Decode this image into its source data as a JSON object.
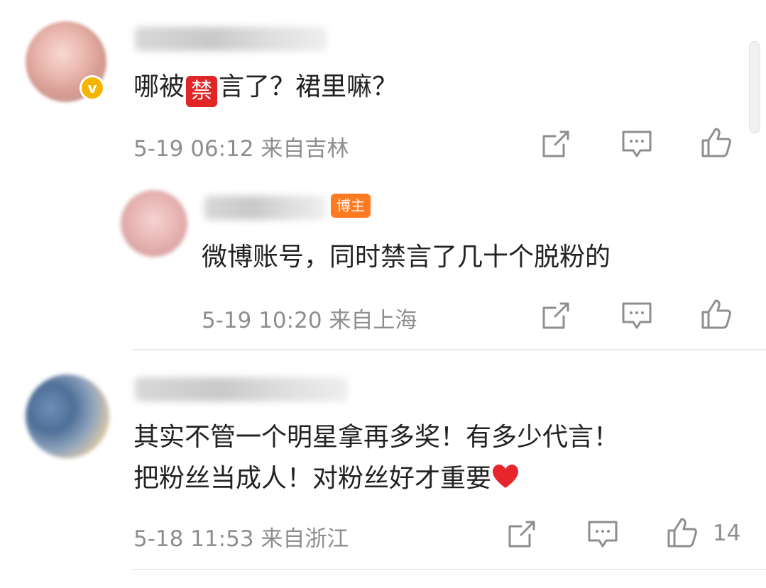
{
  "comments": [
    {
      "text_before": "哪被",
      "emoji": "禁",
      "text_after": "言了？裙里嘛？",
      "date": "5-19 06:12",
      "location": "来自吉林",
      "verified_mark": "v"
    },
    {
      "author_tag": "博主",
      "text": "微博账号，同时禁言了几十个脱粉的",
      "date": "5-19 10:20",
      "location": "来自上海"
    },
    {
      "text_line1": "其实不管一个明星拿再多奖！有多少代言！",
      "text_line2": "把粉丝当成人！对粉丝好才重要",
      "date": "5-18 11:53",
      "location": "来自浙江",
      "like_count": "14"
    }
  ],
  "colors": {
    "author_tag": "#ff7a21",
    "verified": "#f7b500",
    "meta_text": "#8e8e8e",
    "heart": "#e8242c"
  },
  "icons": [
    "share-icon",
    "comment-icon",
    "like-icon",
    "heart-emoji",
    "ban-emoji"
  ]
}
